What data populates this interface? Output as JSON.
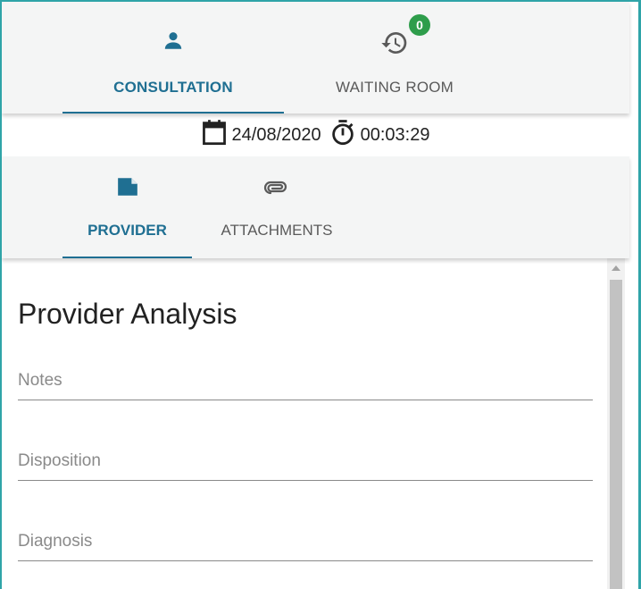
{
  "tabs": {
    "consultation": {
      "label": "CONSULTATION",
      "icon": "person-icon",
      "active": true
    },
    "waiting_room": {
      "label": "WAITING ROOM",
      "icon": "history-icon",
      "badge": "0"
    }
  },
  "session": {
    "date": "24/08/2020",
    "date_icon": "calendar-icon",
    "timer": "00:03:29",
    "timer_icon": "stopwatch-icon"
  },
  "subtabs": {
    "provider": {
      "label": "PROVIDER",
      "icon": "note-icon",
      "active": true
    },
    "attachments": {
      "label": "ATTACHMENTS",
      "icon": "paperclip-icon"
    }
  },
  "form": {
    "title": "Provider Analysis",
    "notes_placeholder": "Notes",
    "disposition_placeholder": "Disposition",
    "diagnosis_placeholder": "Diagnosis"
  },
  "colors": {
    "accent": "#1f6f92",
    "badge": "#2e9d4b",
    "frame": "#2fa4a8"
  }
}
